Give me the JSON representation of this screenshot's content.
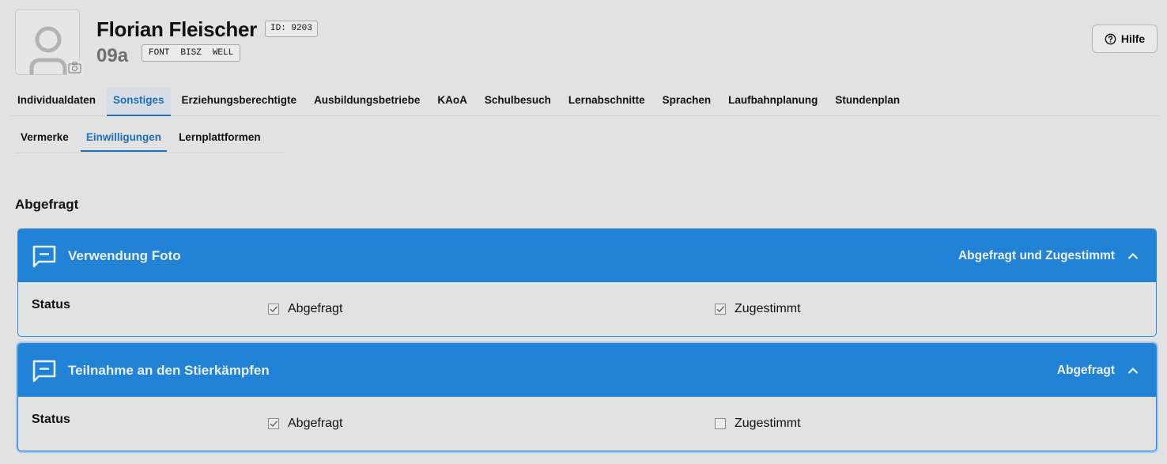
{
  "student": {
    "name": "Florian Fleischer",
    "id_label": "ID: 9203",
    "klasse": "09a",
    "tags": [
      "FONT",
      "BISZ",
      "WELL"
    ]
  },
  "help_label": "Hilfe",
  "tabs": [
    {
      "label": "Individualdaten",
      "active": false
    },
    {
      "label": "Sonstiges",
      "active": true
    },
    {
      "label": "Erziehungsberechtigte",
      "active": false
    },
    {
      "label": "Ausbildungsbetriebe",
      "active": false
    },
    {
      "label": "KAoA",
      "active": false
    },
    {
      "label": "Schulbesuch",
      "active": false
    },
    {
      "label": "Lernabschnitte",
      "active": false
    },
    {
      "label": "Sprachen",
      "active": false
    },
    {
      "label": "Laufbahnplanung",
      "active": false
    },
    {
      "label": "Stundenplan",
      "active": false
    }
  ],
  "subtabs": [
    {
      "label": "Vermerke",
      "active": false
    },
    {
      "label": "Einwilligungen",
      "active": true
    },
    {
      "label": "Lernplattformen",
      "active": false
    }
  ],
  "section_title": "Abgefragt",
  "consents": [
    {
      "title": "Verwendung Foto",
      "status_summary": "Abgefragt und Zugestimmt",
      "status_label": "Status",
      "abgefragt_label": "Abgefragt",
      "abgefragt": true,
      "zugestimmt_label": "Zugestimmt",
      "zugestimmt": true
    },
    {
      "title": "Teilnahme an den Stierkämpfen",
      "status_summary": "Abgefragt",
      "status_label": "Status",
      "abgefragt_label": "Abgefragt",
      "abgefragt": true,
      "zugestimmt_label": "Zugestimmt",
      "zugestimmt": false
    }
  ],
  "colors": {
    "accent": "#1e6fb8",
    "card_header": "#2282d6",
    "background": "#e2e2e2"
  }
}
